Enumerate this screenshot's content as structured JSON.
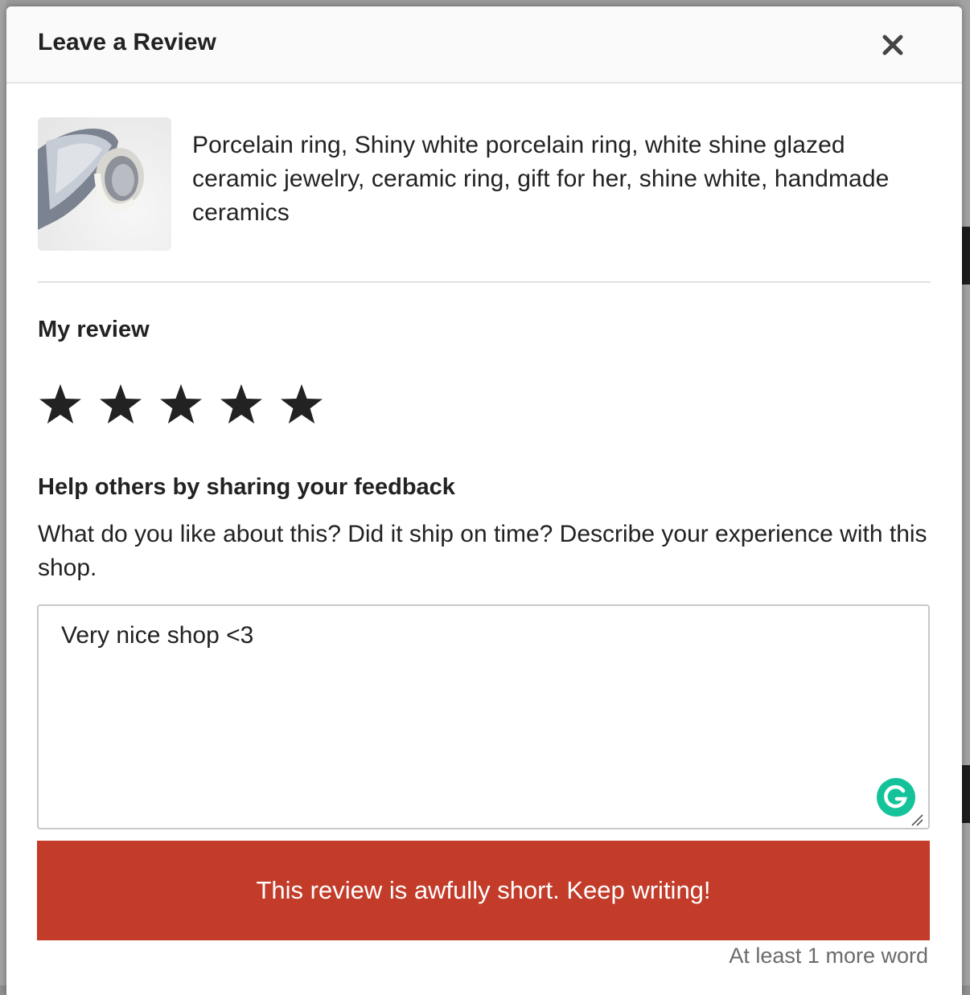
{
  "modal": {
    "title": "Leave a Review",
    "close_icon": "close-icon"
  },
  "listing": {
    "thumbnail_alt": "porcelain-ring-photo",
    "title": "Porcelain ring, Shiny white porcelain ring, white shine glazed ceramic jewelry, ceramic ring, gift for her, shine white, handmade ceramics"
  },
  "review": {
    "label": "My review",
    "rating": 5,
    "rating_max": 5,
    "star_icon": "star-icon"
  },
  "feedback": {
    "heading": "Help others by sharing your feedback",
    "prompt": "What do you like about this? Did it ship on time? Describe your experience with this shop.",
    "value": "Very nice shop <3"
  },
  "validation": {
    "error": "This review is awfully short. Keep writing!",
    "word_hint": "At least 1 more word"
  },
  "colors": {
    "error_bg": "#c33b29",
    "grammarly": "#15c39a",
    "text": "#222222"
  }
}
